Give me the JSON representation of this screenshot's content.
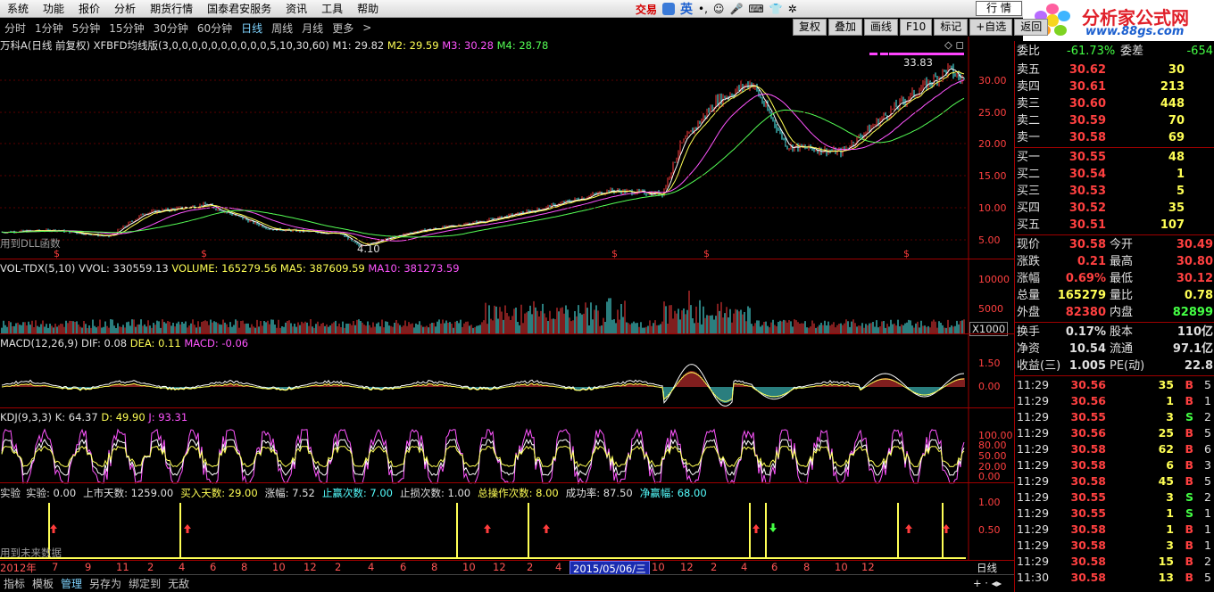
{
  "menu": {
    "items": [
      "系统",
      "功能",
      "报价",
      "分析",
      "期货行情",
      "国泰君安服务",
      "资讯",
      "工具",
      "帮助"
    ],
    "trade": "交易",
    "ime": "英",
    "hq_button": "行 情"
  },
  "logo": {
    "title": "分析家公式网",
    "url": "www.88gs.com"
  },
  "periods": [
    "分时",
    "1分钟",
    "5分钟",
    "15分钟",
    "30分钟",
    "60分钟",
    "日线",
    "周线",
    "月线",
    "更多",
    ">"
  ],
  "active_period": "日线",
  "tools": [
    "复权",
    "叠加",
    "画线",
    "F10",
    "标记",
    "+自选",
    "返回"
  ],
  "price_panel": {
    "title": "万科A(日线 前复权)",
    "indicator": "XFBFD均线版(3,0,0,0,0,0,0,0,0,0,0,5,10,30,60)",
    "m1": "M1: 29.82",
    "m2": "M2: 29.59",
    "m3": "M3: 30.28",
    "m4": "M4: 28.78",
    "dll": "用到DLL函数",
    "high_label": "33.83",
    "low_label": "4.10",
    "yticks": [
      "30.00",
      "25.00",
      "20.00",
      "15.00",
      "10.00",
      "5.00"
    ]
  },
  "vol_panel": {
    "title": "VOL-TDX(5,10)",
    "vvol": "VVOL: 330559.13",
    "volume": "VOLUME: 165279.56",
    "ma5": "MA5: 387609.59",
    "ma10": "MA10: 381273.59",
    "yticks": [
      "10000",
      "5000"
    ],
    "unit": "X1000"
  },
  "macd_panel": {
    "title": "MACD(12,26,9)",
    "dif": "DIF: 0.08",
    "dea": "DEA: 0.11",
    "macd": "MACD: -0.06",
    "yticks": [
      "1.50",
      "0.00"
    ]
  },
  "kdj_panel": {
    "title": "KDJ(9,3,3)",
    "k": "K: 64.37",
    "d": "D: 49.90",
    "j": "J: 93.31",
    "yticks": [
      "100.00",
      "80.00",
      "50.00",
      "20.00",
      "0.00"
    ]
  },
  "signal_panel": {
    "title": "实验",
    "items": [
      {
        "t": "实验: 0.00",
        "c": "#e0e0e0"
      },
      {
        "t": "上市天数: 1259.00",
        "c": "#e0e0e0"
      },
      {
        "t": "买入天数: 29.00",
        "c": "#ffff55"
      },
      {
        "t": "涨幅: 7.52",
        "c": "#e0e0e0"
      },
      {
        "t": "止赢次数: 7.00",
        "c": "#55ffff"
      },
      {
        "t": "止损次数: 1.00",
        "c": "#e0e0e0"
      },
      {
        "t": "总操作次数: 8.00",
        "c": "#ffff55"
      },
      {
        "t": "成功率: 87.50",
        "c": "#e0e0e0"
      },
      {
        "t": "净赢幅: 68.00",
        "c": "#55ffff"
      }
    ],
    "future": "用到未来数据",
    "yticks": [
      "1.00",
      "0.50"
    ]
  },
  "xaxis": {
    "year": "2012年",
    "months": [
      "7",
      "9",
      "11",
      "2",
      "4",
      "6",
      "8",
      "10",
      "12",
      "2",
      "4",
      "6",
      "8",
      "10",
      "12",
      "2",
      "4",
      "6",
      "8",
      "10",
      "12",
      "2",
      "4",
      "6",
      "8",
      "10",
      "12"
    ],
    "cursor_date": "2015/05/06/三",
    "period": "日线"
  },
  "bottom_tabs": [
    "指标",
    "模板",
    "管理",
    "另存为",
    "绑定到",
    "无敌"
  ],
  "active_tab": "管理",
  "quote": {
    "header": {
      "label": "委比",
      "value": "-61.73%",
      "label2": "委差",
      "value2": "-654"
    },
    "asks": [
      {
        "label": "卖五",
        "price": "30.62",
        "vol": "30"
      },
      {
        "label": "卖四",
        "price": "30.61",
        "vol": "213"
      },
      {
        "label": "卖三",
        "price": "30.60",
        "vol": "448"
      },
      {
        "label": "卖二",
        "price": "30.59",
        "vol": "70"
      },
      {
        "label": "卖一",
        "price": "30.58",
        "vol": "69"
      }
    ],
    "bids": [
      {
        "label": "买一",
        "price": "30.55",
        "vol": "48"
      },
      {
        "label": "买二",
        "price": "30.54",
        "vol": "1"
      },
      {
        "label": "买三",
        "price": "30.53",
        "vol": "5"
      },
      {
        "label": "买四",
        "price": "30.52",
        "vol": "35"
      },
      {
        "label": "买五",
        "price": "30.51",
        "vol": "107"
      }
    ],
    "stats": [
      {
        "l1": "现价",
        "v1": "30.58",
        "c1": "#ff4040",
        "l2": "今开",
        "v2": "30.49",
        "c2": "#ff4040"
      },
      {
        "l1": "涨跌",
        "v1": "0.21",
        "c1": "#ff4040",
        "l2": "最高",
        "v2": "30.80",
        "c2": "#ff4040"
      },
      {
        "l1": "涨幅",
        "v1": "0.69%",
        "c1": "#ff4040",
        "l2": "最低",
        "v2": "30.12",
        "c2": "#ff4040"
      },
      {
        "l1": "总量",
        "v1": "165279",
        "c1": "#ffff55",
        "l2": "量比",
        "v2": "0.78",
        "c2": "#ffff55"
      },
      {
        "l1": "外盘",
        "v1": "82380",
        "c1": "#ff4040",
        "l2": "内盘",
        "v2": "82899",
        "c2": "#44ff44"
      }
    ],
    "stats2": [
      {
        "l1": "换手",
        "v1": "0.17%",
        "l2": "股本",
        "v2": "110亿"
      },
      {
        "l1": "净资",
        "v1": "10.54",
        "l2": "流通",
        "v2": "97.1亿"
      },
      {
        "l1": "收益(三)",
        "v1": "1.005",
        "l2": "PE(动)",
        "v2": "22.8"
      }
    ],
    "ticks": [
      {
        "time": "11:29",
        "price": "30.56",
        "vol": "35",
        "side": "B",
        "n": "5"
      },
      {
        "time": "11:29",
        "price": "30.56",
        "vol": "1",
        "side": "B",
        "n": "1"
      },
      {
        "time": "11:29",
        "price": "30.55",
        "vol": "3",
        "side": "S",
        "n": "2"
      },
      {
        "time": "11:29",
        "price": "30.56",
        "vol": "25",
        "side": "B",
        "n": "5"
      },
      {
        "time": "11:29",
        "price": "30.58",
        "vol": "62",
        "side": "B",
        "n": "6"
      },
      {
        "time": "11:29",
        "price": "30.58",
        "vol": "6",
        "side": "B",
        "n": "3"
      },
      {
        "time": "11:29",
        "price": "30.58",
        "vol": "45",
        "side": "B",
        "n": "5"
      },
      {
        "time": "11:29",
        "price": "30.55",
        "vol": "3",
        "side": "S",
        "n": "2"
      },
      {
        "time": "11:29",
        "price": "30.55",
        "vol": "1",
        "side": "S",
        "n": "1"
      },
      {
        "time": "11:29",
        "price": "30.58",
        "vol": "1",
        "side": "B",
        "n": "1"
      },
      {
        "time": "11:29",
        "price": "30.58",
        "vol": "3",
        "side": "B",
        "n": "1"
      },
      {
        "time": "11:29",
        "price": "30.58",
        "vol": "15",
        "side": "B",
        "n": "2"
      },
      {
        "time": "11:30",
        "price": "30.58",
        "vol": "13",
        "side": "B",
        "n": "5"
      }
    ]
  },
  "colors": {
    "up": "#ff3c3c",
    "down": "#54fcfc",
    "yellow": "#ffff55",
    "magenta": "#ff55ff",
    "green": "#55ff55",
    "axis": "#a00000"
  }
}
